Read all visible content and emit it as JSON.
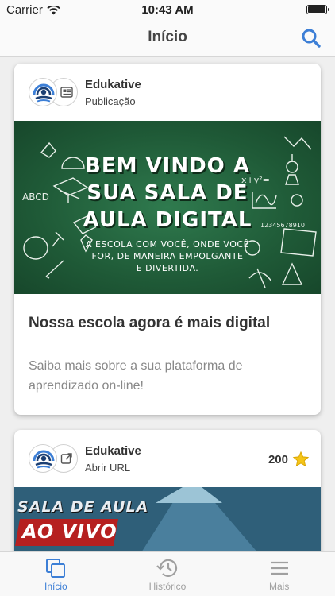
{
  "status_bar": {
    "carrier": "Carrier",
    "time": "10:43 AM"
  },
  "nav": {
    "title": "Início"
  },
  "cards": [
    {
      "source": "Edukative",
      "type": "Publicação",
      "banner": {
        "headline": [
          "BEM VINDO A",
          "SUA SALA DE",
          "AULA DIGITAL"
        ],
        "subtext": [
          "A ESCOLA COM VOCÊ, ONDE VOCÊ",
          "FOR, DE MANEIRA EMPOLGANTE",
          "E DIVERTIDA."
        ]
      },
      "title": "Nossa escola agora é mais digital",
      "description": "Saiba mais sobre a sua plataforma de aprendizado on-line!"
    },
    {
      "source": "Edukative",
      "type": "Abrir URL",
      "points": "200",
      "banner": {
        "line1": "SALA DE AULA",
        "line2": "AO VIVO"
      }
    }
  ],
  "tabs": [
    {
      "label": "Início",
      "icon": "stack-icon",
      "active": true
    },
    {
      "label": "Histórico",
      "icon": "history-icon",
      "active": false
    },
    {
      "label": "Mais",
      "icon": "menu-icon",
      "active": false
    }
  ],
  "colors": {
    "accent": "#3d7fd6",
    "chalkboard": "#1f5a37",
    "inactive_tab": "#a0a0a0",
    "star": "#f5c518",
    "live_red": "#b62020"
  }
}
